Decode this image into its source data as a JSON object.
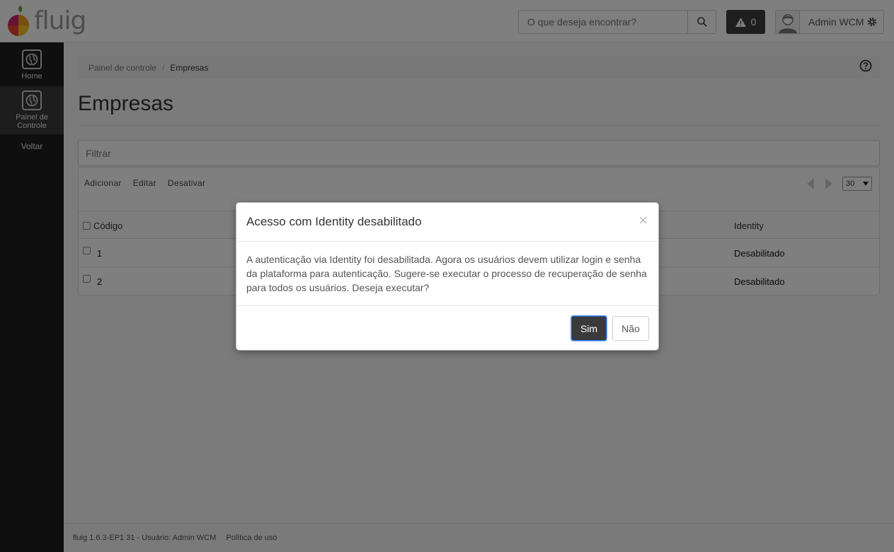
{
  "header": {
    "logo_text": "fluig",
    "search_placeholder": "O que deseja encontrar?",
    "alert_count": "0",
    "user_name": "Admin WCM"
  },
  "sidebar": {
    "items": [
      {
        "label": "Home"
      },
      {
        "label": "Painel de Controle"
      }
    ],
    "back_label": "Voltar"
  },
  "breadcrumb": {
    "root": "Painel de controle",
    "separator": "/",
    "current": "Empresas"
  },
  "page": {
    "title": "Empresas",
    "filter_placeholder": "Filtrar"
  },
  "toolbar": {
    "add_label": "Adicionar",
    "edit_label": "Editar",
    "deactivate_label": "Desativar"
  },
  "pager": {
    "page_size": "30"
  },
  "grid": {
    "columns": {
      "code": "Código",
      "identity": "Identity"
    },
    "rows": [
      {
        "code": "1",
        "identity": "Desabilitado"
      },
      {
        "code": "2",
        "identity": "Desabilitado"
      }
    ]
  },
  "footer": {
    "version_text": "fluig 1.6.3-EP1 31 - Usuário: Admin WCM",
    "policy_link": "Política de uso"
  },
  "modal": {
    "title": "Acesso com Identity desabilitado",
    "close_symbol": "×",
    "body": "A autenticação via Identity foi desabilitada. Agora os usuários devem utilizar login e senha da plataforma para autenticação. Sugere-se executar o processo de recuperação de senha para todos os usuários. Deseja executar?",
    "yes_label": "Sim",
    "no_label": "Não"
  },
  "colors": {
    "sidebar_bg": "#1f1f1f",
    "primary_button": "#3a3a3a",
    "backdrop": "rgba(0,0,0,0.5)"
  }
}
